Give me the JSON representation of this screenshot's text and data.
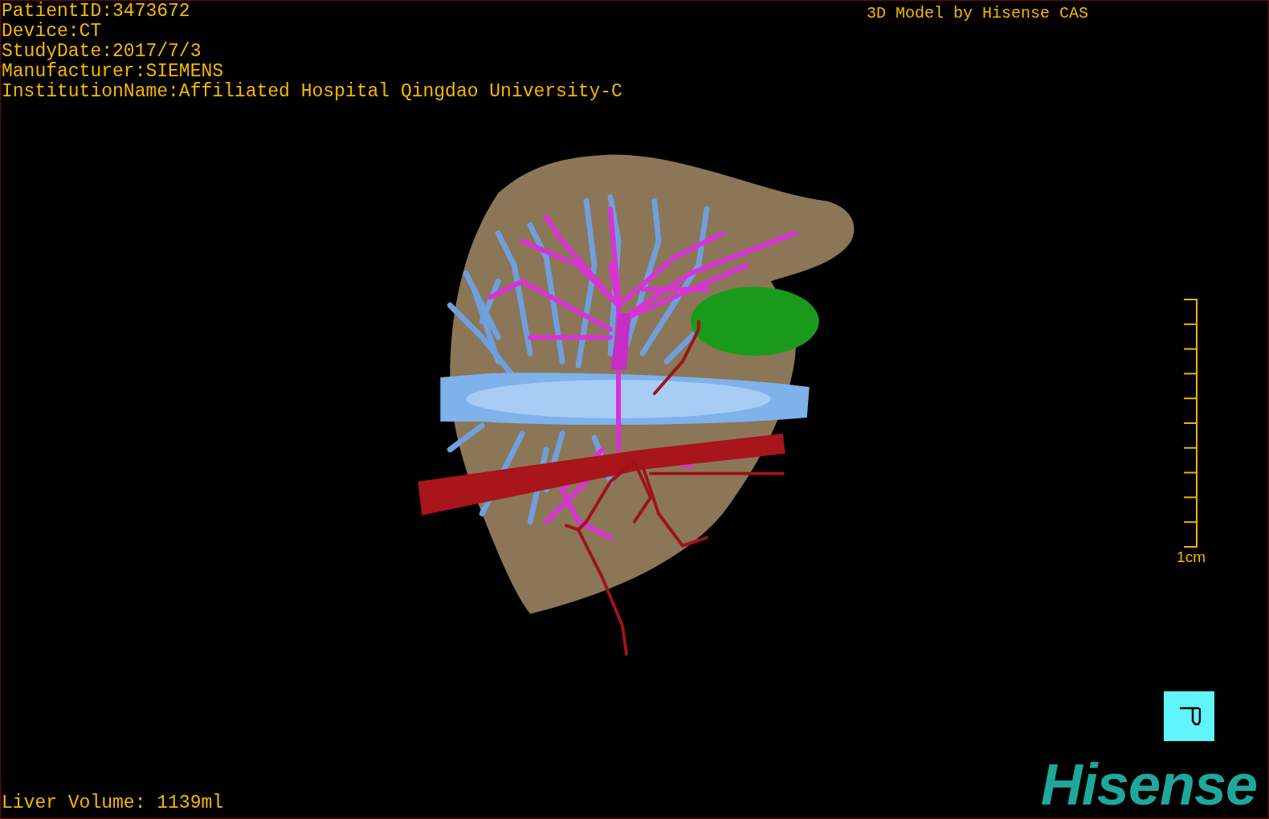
{
  "study_info": [
    "PatientID:3473672",
    "Device:CT",
    "StudyDate:2017/7/3",
    "Manufacturer:SIEMENS",
    "InstitutionName:Affiliated Hospital Qingdao University-C"
  ],
  "title": "3D Model by Hisense CAS",
  "scale": {
    "label": "1cm"
  },
  "liver_volume": "Liver Volume: 1139ml",
  "logo": "Hisense"
}
